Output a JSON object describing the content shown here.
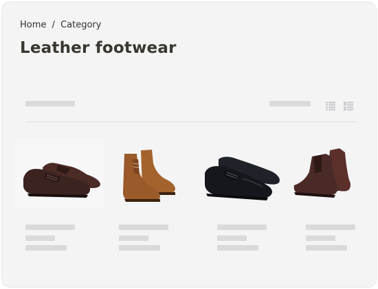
{
  "breadcrumb": {
    "home": "Home",
    "separator": "/",
    "category": "Category"
  },
  "page_title": "Leather footwear",
  "toolbar": {
    "icons": [
      "list-view-icon",
      "grid-view-icon"
    ]
  },
  "products": [
    {
      "icon": "brown-lace-up-derby-shoes",
      "color": "#3b2420"
    },
    {
      "icon": "tan-chukka-boots",
      "color": "#9a5a2a"
    },
    {
      "icon": "black-wingtip-brogues",
      "color": "#15171c"
    },
    {
      "icon": "dark-brown-chelsea-boots",
      "color": "#4a2a26"
    }
  ],
  "colors": {
    "background": "#f4f4f5",
    "title": "#3a3730",
    "skeleton": "#dadadb"
  }
}
